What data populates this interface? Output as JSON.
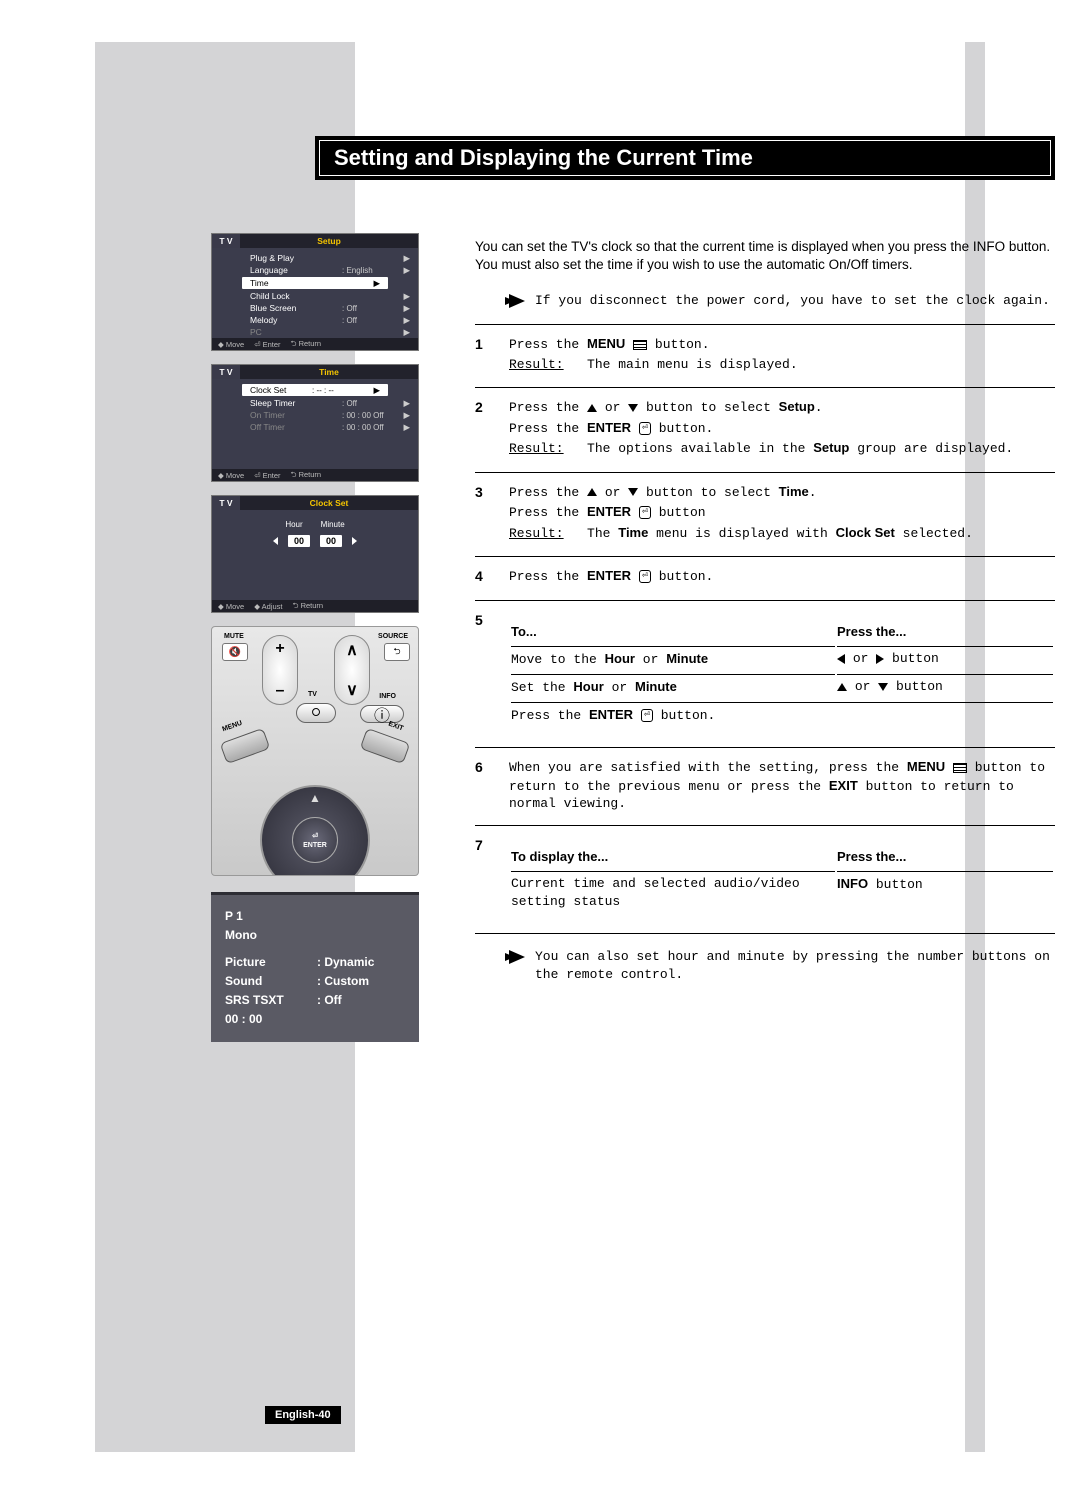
{
  "page": {
    "title": "Setting and Displaying the Current Time",
    "footer": "English-40"
  },
  "osd_setup": {
    "tv": "T V",
    "title": "Setup",
    "rows": [
      {
        "label": "Plug & Play",
        "val": "",
        "arrow": "▶",
        "dim": false,
        "sel": false
      },
      {
        "label": "Language",
        "val": ": English",
        "arrow": "▶",
        "dim": false,
        "sel": false
      },
      {
        "label": "Time",
        "val": "",
        "arrow": "▶",
        "dim": false,
        "sel": true
      },
      {
        "label": "Child Lock",
        "val": "",
        "arrow": "▶",
        "dim": false,
        "sel": false
      },
      {
        "label": "Blue Screen",
        "val": ": Off",
        "arrow": "▶",
        "dim": false,
        "sel": false
      },
      {
        "label": "Melody",
        "val": ": Off",
        "arrow": "▶",
        "dim": false,
        "sel": false
      },
      {
        "label": "PC",
        "val": "",
        "arrow": "▶",
        "dim": true,
        "sel": false
      }
    ],
    "footer": [
      "◆ Move",
      "⏎ Enter",
      "⮌ Return"
    ]
  },
  "osd_time": {
    "tv": "T V",
    "title": "Time",
    "rows": [
      {
        "label": "Clock Set",
        "val": ":   -- : --",
        "arrow": "▶",
        "dim": false,
        "sel": true
      },
      {
        "label": "Sleep Timer",
        "val": ":   Off",
        "arrow": "▶",
        "dim": false,
        "sel": false
      },
      {
        "label": "On Timer",
        "val": ":   00 : 00    Off",
        "arrow": "▶",
        "dim": true,
        "sel": false
      },
      {
        "label": "Off Timer",
        "val": ":   00 : 00    Off",
        "arrow": "▶",
        "dim": true,
        "sel": false
      }
    ],
    "footer": [
      "◆ Move",
      "⏎ Enter",
      "⮌ Return"
    ]
  },
  "osd_clock": {
    "tv": "T V",
    "title": "Clock Set",
    "labels": {
      "hour": "Hour",
      "minute": "Minute"
    },
    "values": {
      "hour": "00",
      "minute": "00"
    },
    "footer": [
      "◆ Move",
      "◆ Adjust",
      "⮌ Return"
    ]
  },
  "remote": {
    "mute": "MUTE",
    "source": "SOURCE",
    "plus": "+",
    "minus": "–",
    "up": "∧",
    "down": "∨",
    "tv": "TV",
    "info": "INFO",
    "menu": "MENU",
    "exit": "EXIT",
    "enter_icon": "⏎",
    "enter": "ENTER"
  },
  "infobox": {
    "p": "P    1",
    "mono": "Mono",
    "rows": [
      {
        "k": "Picture",
        "v": "Dynamic"
      },
      {
        "k": "Sound",
        "v": "Custom"
      },
      {
        "k": "SRS TSXT",
        "v": "Off"
      }
    ],
    "time": "00 : 00"
  },
  "intro": "You can set the TV's clock so that the current time is displayed when you press the INFO button. You must also set the time if you wish to use the automatic On/Off timers.",
  "warn": "If you disconnect the power cord, you have to set the clock again.",
  "steps_text": {
    "menu": "MENU",
    "enter": "ENTER",
    "setup": "Setup",
    "time_w": "Time",
    "clockset": "Clock Set",
    "hour": "Hour",
    "minute": "Minute",
    "exit": "EXIT",
    "info": "INFO",
    "press_the_pre": "Press the ",
    "button_suf": " button.",
    "button_suf2": " button",
    "result": "Result:",
    "r1": "The main menu is displayed.",
    "s2a": "Press the ",
    "s2b": " or ",
    "s2c": " button to select ",
    "r2": "The options available in the ",
    "r2b": " group are displayed.",
    "r3a": "The ",
    "r3b": " menu is displayed with ",
    "r3c": " selected.",
    "to": "To...",
    "pressthe": "Press the...",
    "move_to": "Move to the ",
    "or": " or ",
    "set_the": "Set the ",
    "s6": "When you are satisfied with the setting, press the ",
    "s6b": " button to return to the previous menu or press the ",
    "s6c": " button to return to normal viewing.",
    "to_display": "To display the...",
    "s7a": "Current time and selected audio/video setting status",
    "note2": "You can also set hour and minute by pressing the number buttons on the remote control."
  }
}
